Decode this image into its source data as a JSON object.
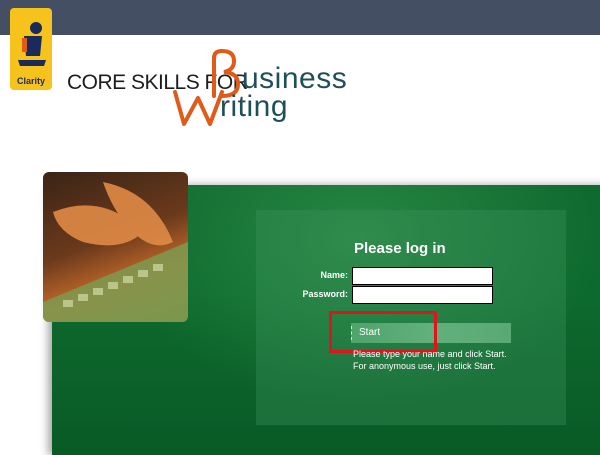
{
  "header": {
    "logo_text": "Clarity",
    "title_prefix": "CORE SKILLS FOR",
    "title_line1": "usiness",
    "title_line2": "riting"
  },
  "login": {
    "title": "Please log in",
    "name_label": "Name:",
    "password_label": "Password:",
    "name_value": "",
    "password_value": "",
    "start_label": "Start",
    "hint_line1": "Please type your name and click Start.",
    "hint_line2": "For anonymous use, just click Start."
  },
  "colors": {
    "topbar": "#444f63",
    "accent_orange": "#e05a1a",
    "title_teal": "#1f4f58",
    "panel_green": "#0d6a2e",
    "highlight_red": "#e0141b"
  }
}
